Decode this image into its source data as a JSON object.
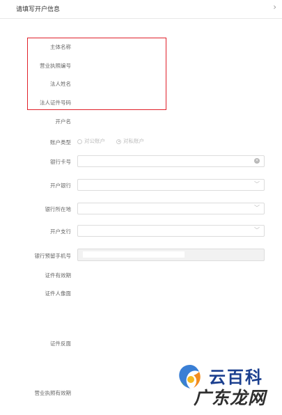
{
  "header": {
    "title": "请填写开户信息",
    "chevron_icon": "chevron-right-icon"
  },
  "form": {
    "subject_name_label": "主体名称",
    "license_no_label": "营业执照编号",
    "legal_name_label": "法人姓名",
    "legal_id_label": "法人证件号码",
    "account_name_label": "开户名",
    "account_type_label": "账户类型",
    "account_type_options": [
      "对公账户",
      "对私账户"
    ],
    "account_type_selected": "对私账户",
    "bank_card_label": "银行卡号",
    "bank_label": "开户银行",
    "bank_location_label": "银行所在地",
    "branch_label": "开户支行",
    "reserved_phone_label": "银行预留手机号",
    "id_validity_label": "证件有效期",
    "id_front_label": "证件人像面",
    "id_back_label": "证件反面",
    "license_validity_label": "营业执照有效期"
  },
  "watermark": {
    "line1": "云百科",
    "line2": "广东龙网"
  },
  "colors": {
    "highlight_box": "#e0202a",
    "watermark_blue": "#1b3f8f"
  }
}
